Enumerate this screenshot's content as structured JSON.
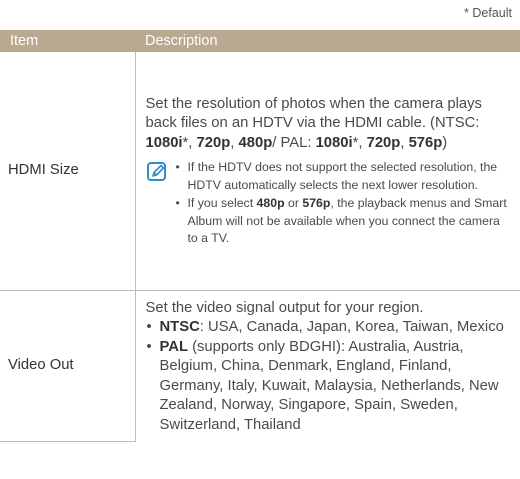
{
  "default_note": "* Default",
  "headers": {
    "item": "Item",
    "description": "Description"
  },
  "hdmi": {
    "item": "HDMI Size",
    "intro": "Set the resolution of photos when the camera plays back files on an HDTV via the HDMI cable. (NTSC: ",
    "ntsc_1080i": "1080i",
    "star": "*",
    "sep1": ", ",
    "ntsc_720p": "720p",
    "ntsc_480p": "480p",
    "pal_label": "/ PAL: ",
    "pal_1080i": "1080i",
    "pal_720p": "720p",
    "pal_576p": "576p",
    "close": ")",
    "note1": "If the HDTV does not support the selected resolution, the HDTV automatically selects the next lower resolution.",
    "note2_pre": "If you select ",
    "note2_480p": "480p",
    "note2_or": " or ",
    "note2_576p": "576p",
    "note2_post": ", the playback menus and Smart Album will not be available when you connect the camera to a TV."
  },
  "video_out": {
    "item": "Video Out",
    "intro": "Set the video signal output for your region.",
    "ntsc_label": "NTSC",
    "ntsc_text": ": USA, Canada, Japan, Korea, Taiwan, Mexico",
    "pal_label": "PAL",
    "pal_text": " (supports only BDGHI): Australia, Austria, Belgium, China, Denmark, England, Finland, Germany, Italy, Kuwait, Malaysia, Netherlands, New Zealand, Norway, Singapore, Spain, Sweden, Switzerland, Thailand"
  },
  "icons": {
    "note": "note-pencil-icon"
  },
  "colors": {
    "header_bg": "#b8a990",
    "icon": "#2b8fc8"
  }
}
